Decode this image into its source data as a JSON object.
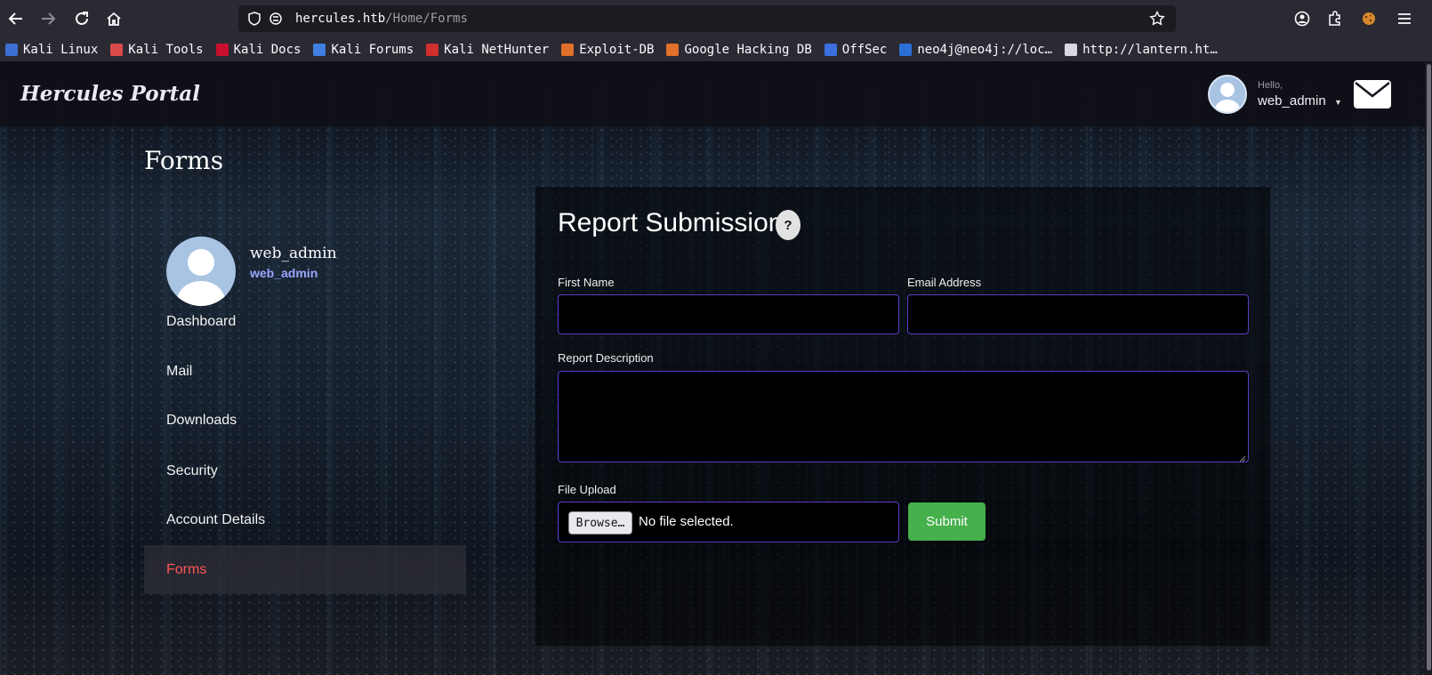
{
  "browser": {
    "url_host": "hercules.htb",
    "url_path": "/Home/Forms",
    "bookmarks": [
      {
        "label": "Kali Linux",
        "icon": "kali-icon",
        "color": "#3b6fd1"
      },
      {
        "label": "Kali Tools",
        "icon": "kali-tools-icon",
        "color": "#d94a4a"
      },
      {
        "label": "Kali Docs",
        "icon": "kali-docs-icon",
        "color": "#c8102e"
      },
      {
        "label": "Kali Forums",
        "icon": "kali-forums-icon",
        "color": "#3f7fe0"
      },
      {
        "label": "Kali NetHunter",
        "icon": "nethunter-icon",
        "color": "#d12e2e"
      },
      {
        "label": "Exploit-DB",
        "icon": "exploit-db-icon",
        "color": "#e0702a"
      },
      {
        "label": "Google Hacking DB",
        "icon": "ghdb-icon",
        "color": "#e0702a"
      },
      {
        "label": "OffSec",
        "icon": "offsec-icon",
        "color": "#3b6fe0"
      },
      {
        "label": "neo4j@neo4j://loc…",
        "icon": "terminal-icon",
        "color": "#2a6fd6"
      },
      {
        "label": "http://lantern.ht…",
        "icon": "page-icon",
        "color": "#d8d8e0"
      }
    ]
  },
  "header": {
    "brand": "Hercules Portal",
    "greeting": "Hello,",
    "username": "web_admin"
  },
  "page": {
    "title": "Forms"
  },
  "profile": {
    "name": "web_admin",
    "role": "web_admin"
  },
  "nav": {
    "dashboard": "Dashboard",
    "mail": "Mail",
    "downloads": "Downloads",
    "security": "Security",
    "account": "Account Details",
    "forms": "Forms"
  },
  "form": {
    "title": "Report Submission",
    "help": "?",
    "first_name_label": "First Name",
    "first_name_value": "",
    "email_label": "Email Address",
    "email_value": "",
    "description_label": "Report Description",
    "description_value": "",
    "file_label": "File Upload",
    "browse_label": "Browse…",
    "file_status": "No file selected.",
    "submit_label": "Submit"
  },
  "colors": {
    "accent": "#5b3dc6",
    "active_nav": "#ff5555",
    "role": "#9aa7ff",
    "submit": "#45b04c"
  }
}
